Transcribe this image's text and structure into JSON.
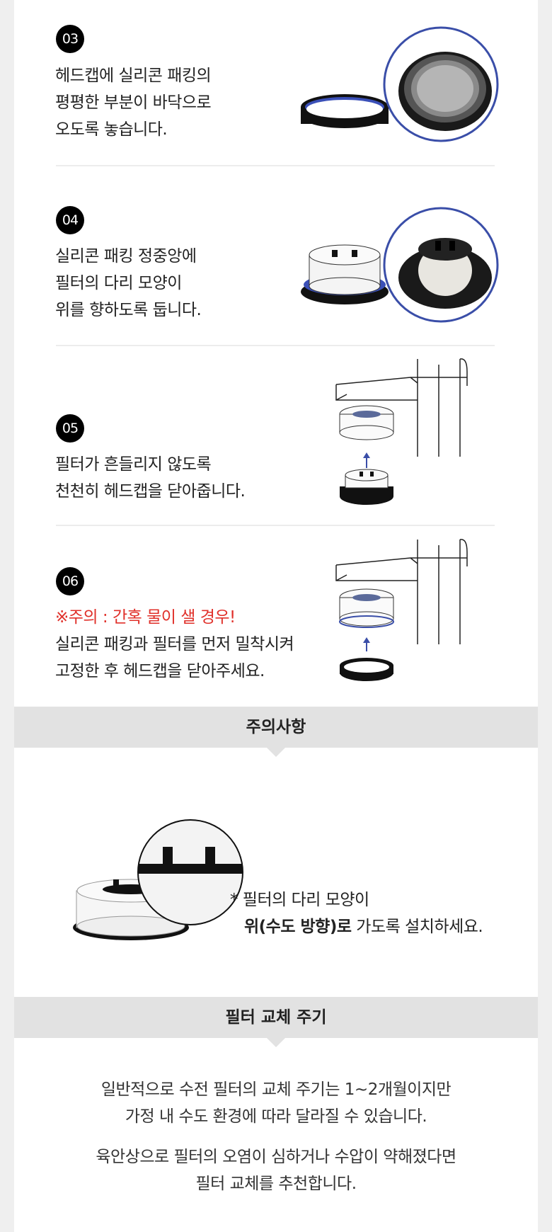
{
  "steps": [
    {
      "number": "03",
      "lines": [
        "헤드캡에 실리콘 패킹의",
        "평평한 부분이 바닥으로",
        "오도록 놓습니다."
      ]
    },
    {
      "number": "04",
      "lines": [
        "실리콘 패킹 정중앙에",
        "필터의 다리 모양이",
        "위를 향하도록 둡니다."
      ]
    },
    {
      "number": "05",
      "lines": [
        "필터가 흔들리지 않도록",
        "천천히 헤드캡을 닫아줍니다."
      ]
    },
    {
      "number": "06",
      "warning": "※주의 : 간혹 물이 샐 경우!",
      "lines": [
        "실리콘 패킹과 필터를 먼저 밀착시켜",
        "고정한 후 헤드캡을 닫아주세요."
      ]
    }
  ],
  "caution": {
    "title": "주의사항",
    "line1": "* 필터의 다리 모양이",
    "line2_bold": "위(수도 방향)로",
    "line2_rest": " 가도록 설치하세요."
  },
  "cycle": {
    "title": "필터 교체 주기",
    "para1": [
      "일반적으로 수전 필터의 교체 주기는 1~2개월이지만",
      "가정 내 수도 환경에 따라 달라질 수 있습니다."
    ],
    "para2": [
      "육안상으로 필터의 오염이 심하거나 수압이 약해졌다면",
      "필터 교체를 추천합니다."
    ]
  },
  "colors": {
    "accent_blue": "#3a4ea8",
    "warning_red": "#e0302a",
    "section_bar": "#e2e2e2"
  }
}
